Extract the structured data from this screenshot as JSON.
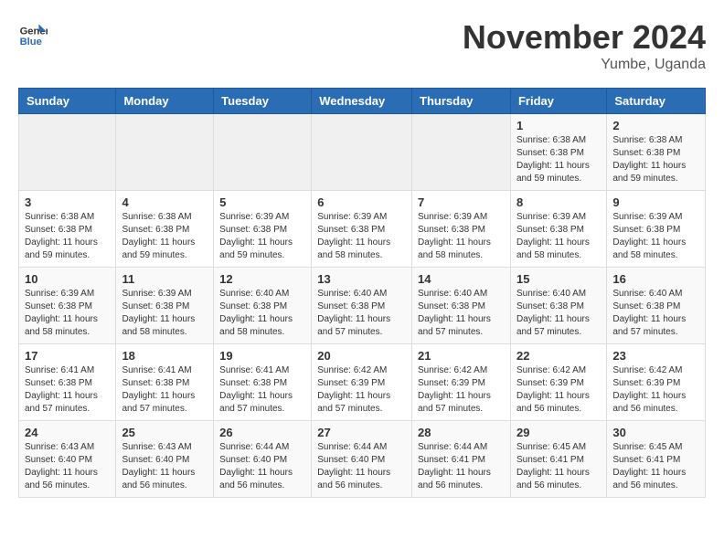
{
  "header": {
    "logo_general": "General",
    "logo_blue": "Blue",
    "month_title": "November 2024",
    "location": "Yumbe, Uganda"
  },
  "weekdays": [
    "Sunday",
    "Monday",
    "Tuesday",
    "Wednesday",
    "Thursday",
    "Friday",
    "Saturday"
  ],
  "weeks": [
    [
      {
        "day": "",
        "info": ""
      },
      {
        "day": "",
        "info": ""
      },
      {
        "day": "",
        "info": ""
      },
      {
        "day": "",
        "info": ""
      },
      {
        "day": "",
        "info": ""
      },
      {
        "day": "1",
        "info": "Sunrise: 6:38 AM\nSunset: 6:38 PM\nDaylight: 11 hours and 59 minutes."
      },
      {
        "day": "2",
        "info": "Sunrise: 6:38 AM\nSunset: 6:38 PM\nDaylight: 11 hours and 59 minutes."
      }
    ],
    [
      {
        "day": "3",
        "info": "Sunrise: 6:38 AM\nSunset: 6:38 PM\nDaylight: 11 hours and 59 minutes."
      },
      {
        "day": "4",
        "info": "Sunrise: 6:38 AM\nSunset: 6:38 PM\nDaylight: 11 hours and 59 minutes."
      },
      {
        "day": "5",
        "info": "Sunrise: 6:39 AM\nSunset: 6:38 PM\nDaylight: 11 hours and 59 minutes."
      },
      {
        "day": "6",
        "info": "Sunrise: 6:39 AM\nSunset: 6:38 PM\nDaylight: 11 hours and 58 minutes."
      },
      {
        "day": "7",
        "info": "Sunrise: 6:39 AM\nSunset: 6:38 PM\nDaylight: 11 hours and 58 minutes."
      },
      {
        "day": "8",
        "info": "Sunrise: 6:39 AM\nSunset: 6:38 PM\nDaylight: 11 hours and 58 minutes."
      },
      {
        "day": "9",
        "info": "Sunrise: 6:39 AM\nSunset: 6:38 PM\nDaylight: 11 hours and 58 minutes."
      }
    ],
    [
      {
        "day": "10",
        "info": "Sunrise: 6:39 AM\nSunset: 6:38 PM\nDaylight: 11 hours and 58 minutes."
      },
      {
        "day": "11",
        "info": "Sunrise: 6:39 AM\nSunset: 6:38 PM\nDaylight: 11 hours and 58 minutes."
      },
      {
        "day": "12",
        "info": "Sunrise: 6:40 AM\nSunset: 6:38 PM\nDaylight: 11 hours and 58 minutes."
      },
      {
        "day": "13",
        "info": "Sunrise: 6:40 AM\nSunset: 6:38 PM\nDaylight: 11 hours and 57 minutes."
      },
      {
        "day": "14",
        "info": "Sunrise: 6:40 AM\nSunset: 6:38 PM\nDaylight: 11 hours and 57 minutes."
      },
      {
        "day": "15",
        "info": "Sunrise: 6:40 AM\nSunset: 6:38 PM\nDaylight: 11 hours and 57 minutes."
      },
      {
        "day": "16",
        "info": "Sunrise: 6:40 AM\nSunset: 6:38 PM\nDaylight: 11 hours and 57 minutes."
      }
    ],
    [
      {
        "day": "17",
        "info": "Sunrise: 6:41 AM\nSunset: 6:38 PM\nDaylight: 11 hours and 57 minutes."
      },
      {
        "day": "18",
        "info": "Sunrise: 6:41 AM\nSunset: 6:38 PM\nDaylight: 11 hours and 57 minutes."
      },
      {
        "day": "19",
        "info": "Sunrise: 6:41 AM\nSunset: 6:38 PM\nDaylight: 11 hours and 57 minutes."
      },
      {
        "day": "20",
        "info": "Sunrise: 6:42 AM\nSunset: 6:39 PM\nDaylight: 11 hours and 57 minutes."
      },
      {
        "day": "21",
        "info": "Sunrise: 6:42 AM\nSunset: 6:39 PM\nDaylight: 11 hours and 57 minutes."
      },
      {
        "day": "22",
        "info": "Sunrise: 6:42 AM\nSunset: 6:39 PM\nDaylight: 11 hours and 56 minutes."
      },
      {
        "day": "23",
        "info": "Sunrise: 6:42 AM\nSunset: 6:39 PM\nDaylight: 11 hours and 56 minutes."
      }
    ],
    [
      {
        "day": "24",
        "info": "Sunrise: 6:43 AM\nSunset: 6:40 PM\nDaylight: 11 hours and 56 minutes."
      },
      {
        "day": "25",
        "info": "Sunrise: 6:43 AM\nSunset: 6:40 PM\nDaylight: 11 hours and 56 minutes."
      },
      {
        "day": "26",
        "info": "Sunrise: 6:44 AM\nSunset: 6:40 PM\nDaylight: 11 hours and 56 minutes."
      },
      {
        "day": "27",
        "info": "Sunrise: 6:44 AM\nSunset: 6:40 PM\nDaylight: 11 hours and 56 minutes."
      },
      {
        "day": "28",
        "info": "Sunrise: 6:44 AM\nSunset: 6:41 PM\nDaylight: 11 hours and 56 minutes."
      },
      {
        "day": "29",
        "info": "Sunrise: 6:45 AM\nSunset: 6:41 PM\nDaylight: 11 hours and 56 minutes."
      },
      {
        "day": "30",
        "info": "Sunrise: 6:45 AM\nSunset: 6:41 PM\nDaylight: 11 hours and 56 minutes."
      }
    ]
  ]
}
